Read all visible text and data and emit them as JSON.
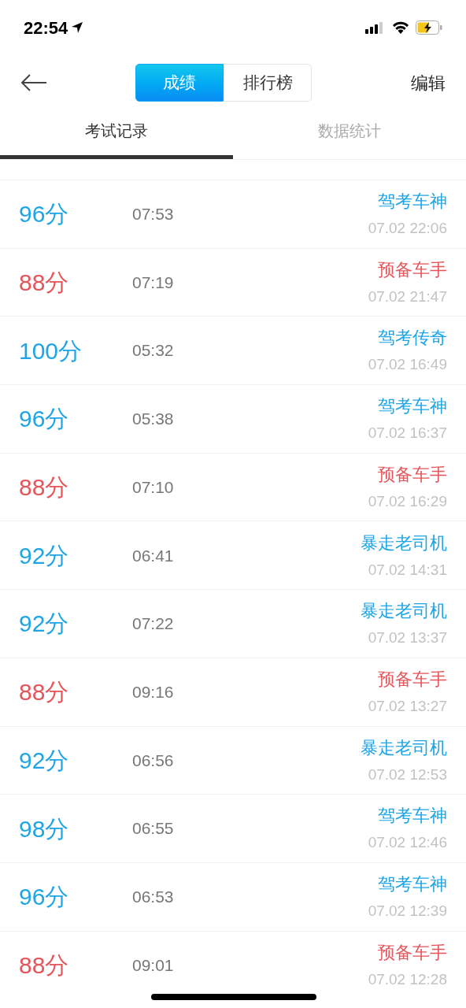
{
  "status_bar": {
    "time": "22:54"
  },
  "header": {
    "segments": [
      {
        "label": "成绩",
        "selected": true
      },
      {
        "label": "排行榜",
        "selected": false
      }
    ],
    "edit": "编辑"
  },
  "tabs": [
    {
      "label": "考试记录",
      "selected": true
    },
    {
      "label": "数据统计",
      "selected": false
    }
  ],
  "records": [
    {
      "score": "96分",
      "duration": "07:53",
      "title": "驾考车神",
      "date": "07.02 22:06",
      "passed": true
    },
    {
      "score": "88分",
      "duration": "07:19",
      "title": "预备车手",
      "date": "07.02 21:47",
      "passed": false
    },
    {
      "score": "100分",
      "duration": "05:32",
      "title": "驾考传奇",
      "date": "07.02 16:49",
      "passed": true
    },
    {
      "score": "96分",
      "duration": "05:38",
      "title": "驾考车神",
      "date": "07.02 16:37",
      "passed": true
    },
    {
      "score": "88分",
      "duration": "07:10",
      "title": "预备车手",
      "date": "07.02 16:29",
      "passed": false
    },
    {
      "score": "92分",
      "duration": "06:41",
      "title": "暴走老司机",
      "date": "07.02 14:31",
      "passed": true
    },
    {
      "score": "92分",
      "duration": "07:22",
      "title": "暴走老司机",
      "date": "07.02 13:37",
      "passed": true
    },
    {
      "score": "88分",
      "duration": "09:16",
      "title": "预备车手",
      "date": "07.02 13:27",
      "passed": false
    },
    {
      "score": "92分",
      "duration": "06:56",
      "title": "暴走老司机",
      "date": "07.02 12:53",
      "passed": true
    },
    {
      "score": "98分",
      "duration": "06:55",
      "title": "驾考车神",
      "date": "07.02 12:46",
      "passed": true
    },
    {
      "score": "96分",
      "duration": "06:53",
      "title": "驾考车神",
      "date": "07.02 12:39",
      "passed": true
    },
    {
      "score": "88分",
      "duration": "09:01",
      "title": "预备车手",
      "date": "07.02 12:28",
      "passed": false
    }
  ]
}
